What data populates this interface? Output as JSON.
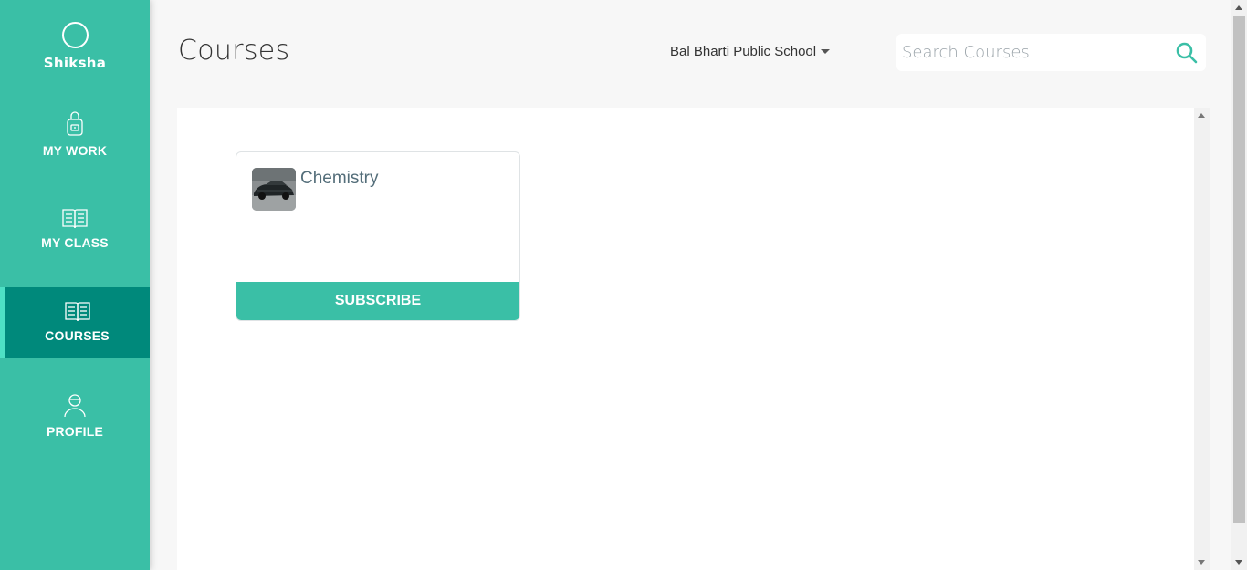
{
  "app": {
    "brand_name": "Shiksha",
    "accent_color": "#3abfa6",
    "active_nav_color": "#00897b"
  },
  "sidebar": {
    "items": [
      {
        "label": "MY WORK",
        "icon": "backpack-icon",
        "active": false
      },
      {
        "label": "MY CLASS",
        "icon": "book-icon",
        "active": false
      },
      {
        "label": "COURSES",
        "icon": "book-icon",
        "active": true
      },
      {
        "label": "PROFILE",
        "icon": "user-icon",
        "active": false
      }
    ]
  },
  "header": {
    "title": "Courses",
    "school_selected": "Bal Bharti Public School",
    "search_placeholder": "Search Courses",
    "search_value": ""
  },
  "courses": [
    {
      "title": "Chemistry",
      "thumbnail": "car-photo",
      "action_label": "SUBSCRIBE"
    }
  ]
}
